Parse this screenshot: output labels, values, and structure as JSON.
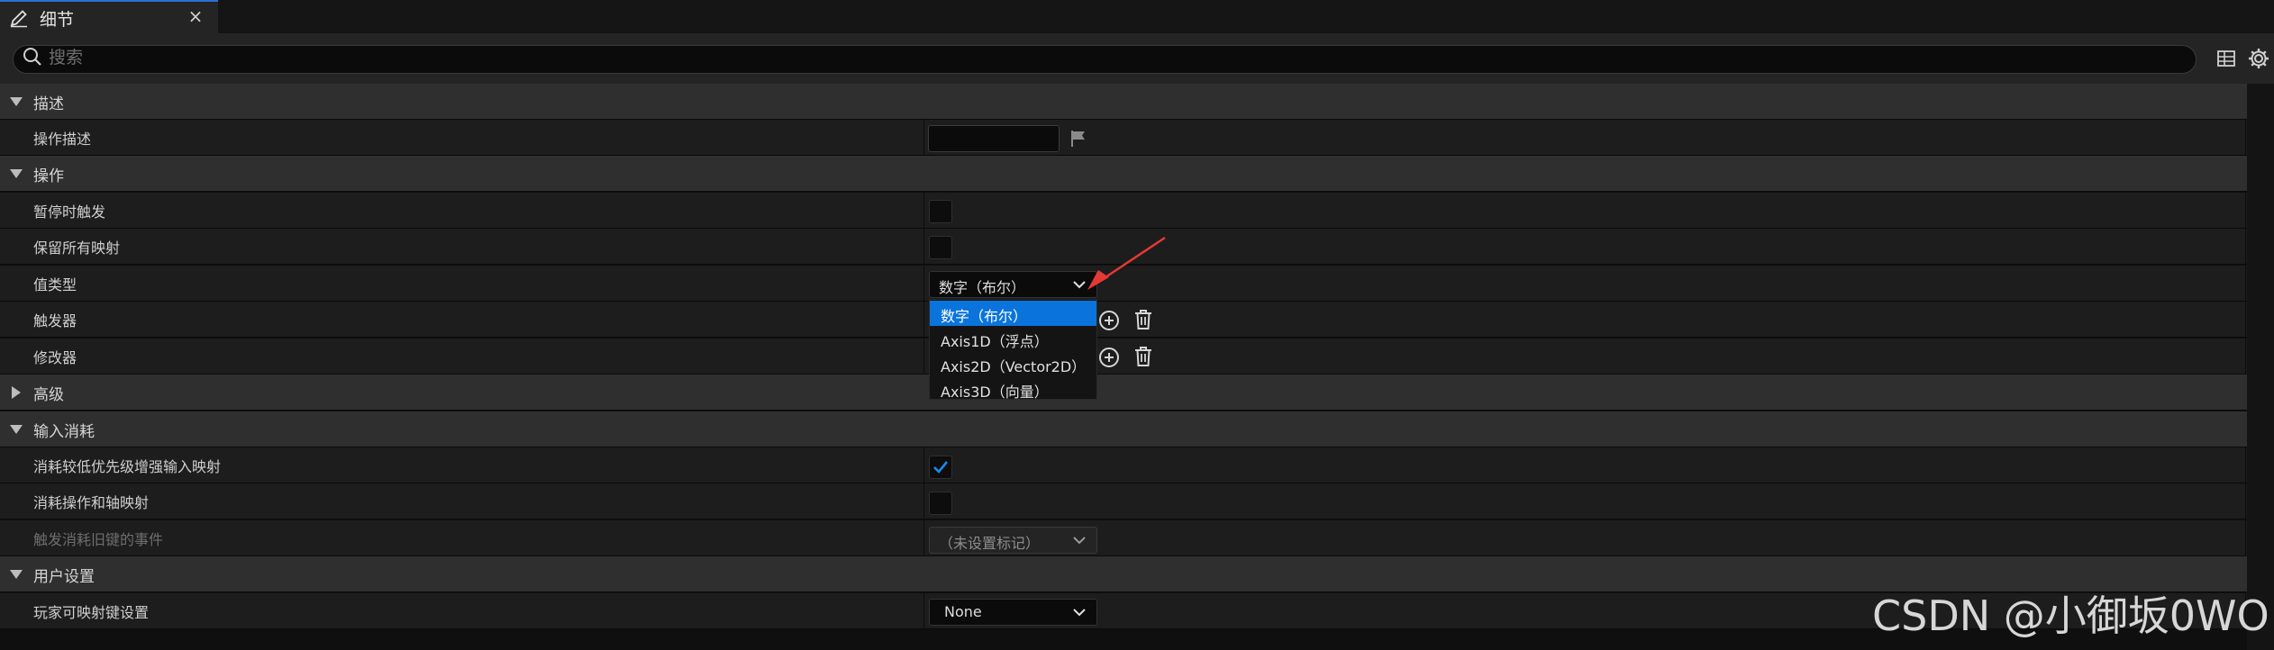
{
  "tab": {
    "title": "细节",
    "close_glyph": "×",
    "icon": "pencil-icon"
  },
  "search": {
    "placeholder": "搜索",
    "value": ""
  },
  "toolbar": {
    "table_icon": "table-icon",
    "settings_icon": "gear-icon"
  },
  "sections": {
    "description": {
      "label": "描述",
      "expanded": true,
      "action_description": {
        "label": "操作描述",
        "value": ""
      }
    },
    "action": {
      "label": "操作",
      "expanded": true,
      "trigger_when_paused": {
        "label": "暂停时触发",
        "checked": false
      },
      "reserve_all_mappings": {
        "label": "保留所有映射",
        "checked": false
      },
      "value_type": {
        "label": "值类型",
        "selected": "数字（布尔）",
        "options": [
          "数字（布尔）",
          "Axis1D（浮点）",
          "Axis2D（Vector2D）",
          "Axis3D（向量）"
        ],
        "highlighted_index": 0
      },
      "triggers": {
        "label": "触发器"
      },
      "modifiers": {
        "label": "修改器"
      }
    },
    "advanced": {
      "label": "高级",
      "expanded": false
    },
    "input_consumption": {
      "label": "输入消耗",
      "expanded": true,
      "consume_lower_priority": {
        "label": "消耗较低优先级增强输入映射",
        "checked": true
      },
      "consume_action_axis": {
        "label": "消耗操作和轴映射",
        "checked": false
      },
      "trigger_legacy_events": {
        "label": "触发消耗旧键的事件",
        "value": "（未设置标记）",
        "enabled": false
      }
    },
    "user_settings": {
      "label": "用户设置",
      "expanded": true,
      "player_mappable": {
        "label": "玩家可映射键设置",
        "value": "None"
      }
    }
  },
  "colors": {
    "accent": "#0a74dc",
    "annotation_arrow": "#e53935",
    "tab_highlight": "#2c6fd6"
  },
  "watermark": "CSDN @小御坂0WO"
}
